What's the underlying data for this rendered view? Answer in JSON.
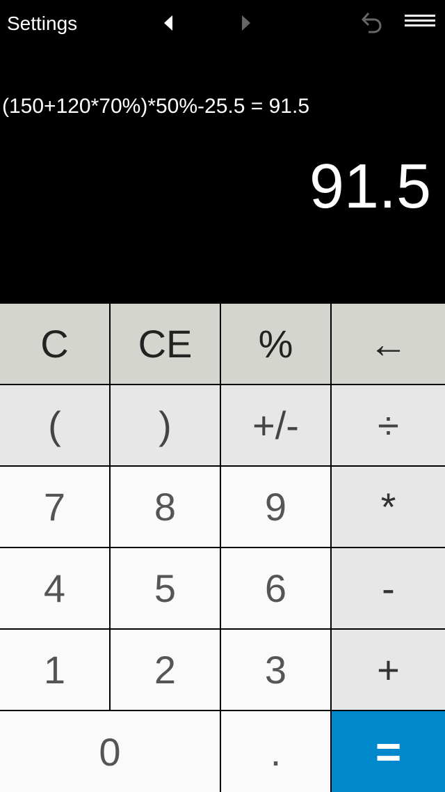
{
  "header": {
    "settings_label": "Settings",
    "icons": [
      "back-arrow-icon",
      "forward-arrow-icon",
      "undo-icon",
      "menu-icon"
    ]
  },
  "display": {
    "expression": "(150+120*70%)*50%-25.5 = 91.5",
    "result": "91.5"
  },
  "keys": {
    "c": "C",
    "ce": "CE",
    "percent": "%",
    "backspace": "←",
    "open_paren": "(",
    "close_paren": ")",
    "negate": "+/-",
    "divide": "÷",
    "seven": "7",
    "eight": "8",
    "nine": "9",
    "multiply": "*",
    "four": "4",
    "five": "5",
    "six": "6",
    "subtract": "-",
    "one": "1",
    "two": "2",
    "three": "3",
    "add": "+",
    "zero": "0",
    "decimal": ".",
    "equals": "="
  },
  "colors": {
    "equals_bg": "#0088cc",
    "top_row_bg": "#d5d5cf",
    "operator_bg": "#e7e7e7",
    "number_bg": "#fafafa"
  }
}
